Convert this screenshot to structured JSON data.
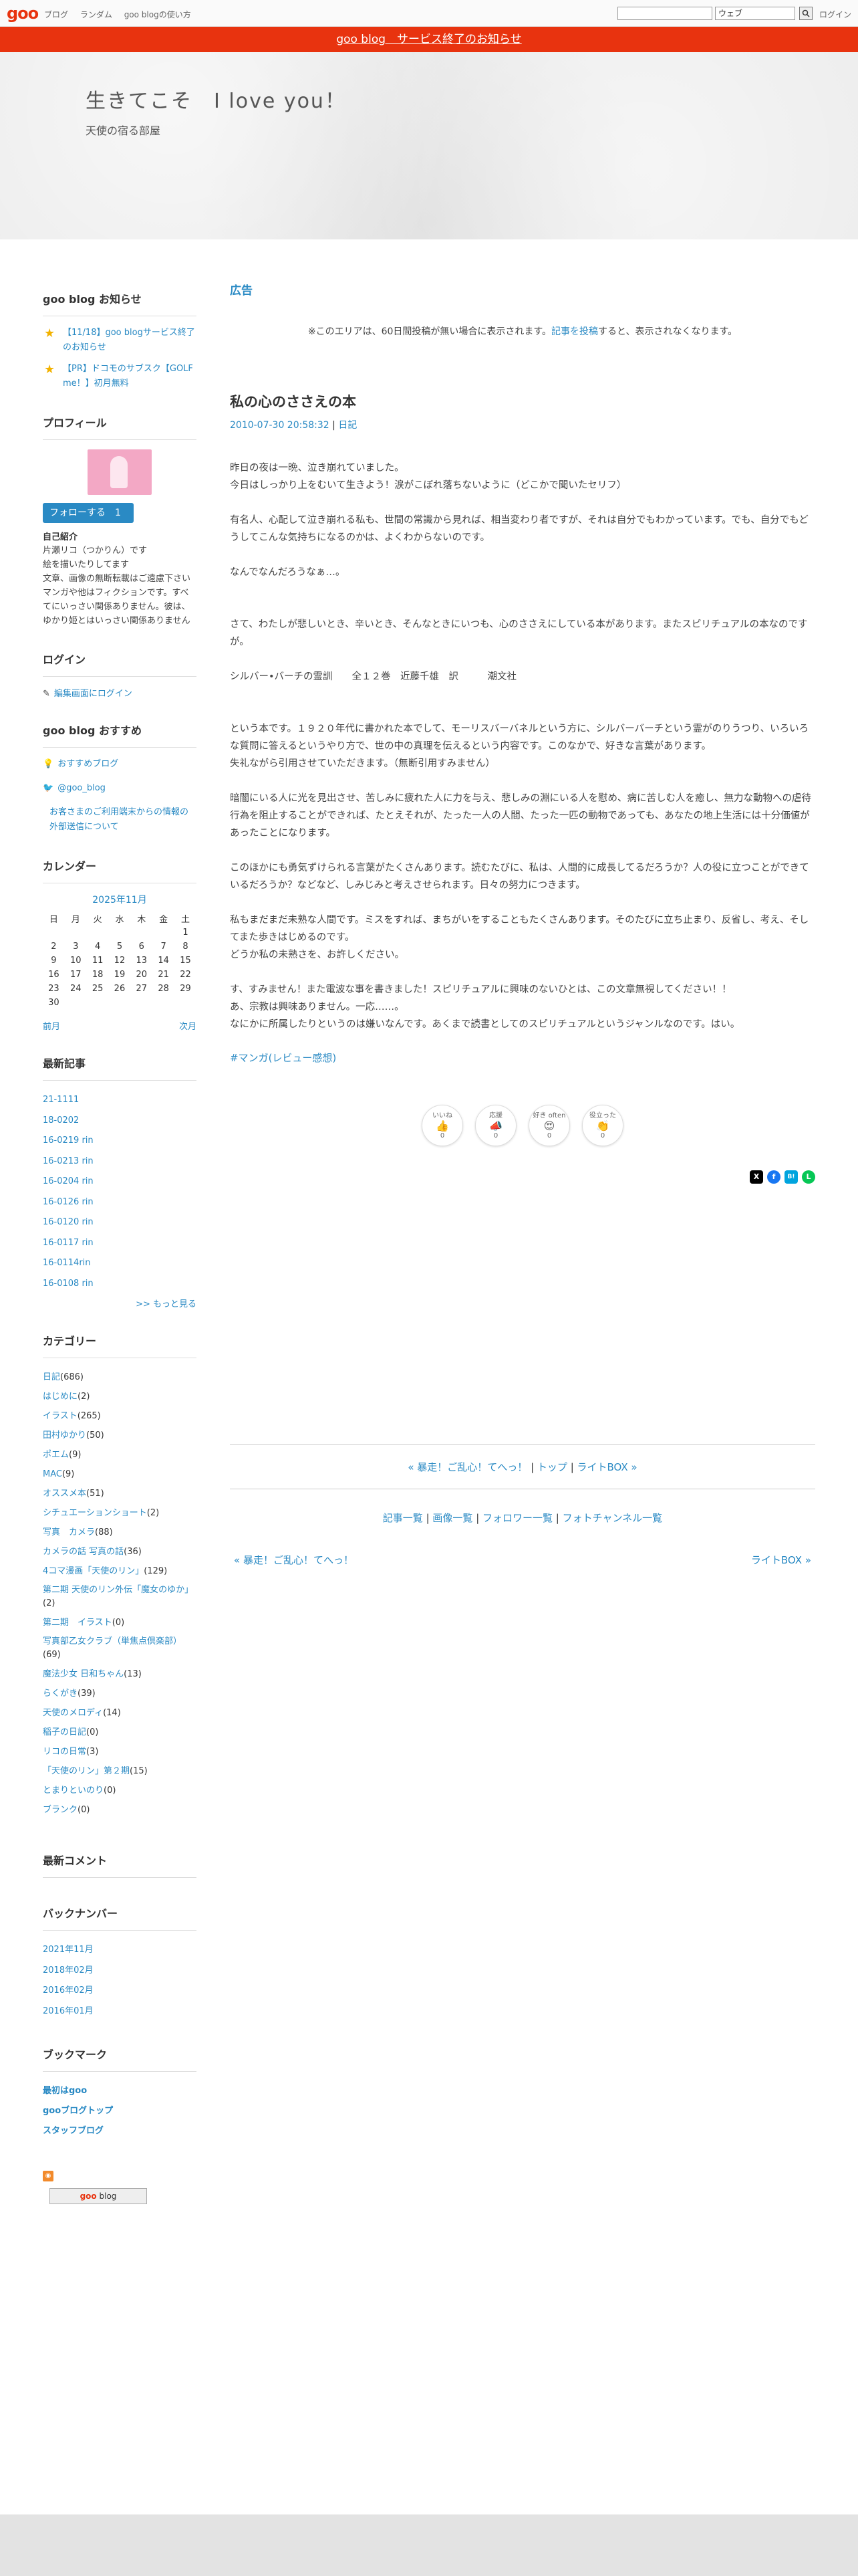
{
  "topbar": {
    "logo": "goo",
    "nav": [
      "ブログ",
      "ランダム",
      "goo blogの使い方"
    ],
    "search_select": "ウェブ",
    "login": "ログイン"
  },
  "notice": "goo blog　サービス終了のお知らせ",
  "header": {
    "title": "生きてこそ　I love you！",
    "description": "天使の宿る部屋"
  },
  "sidebar": {
    "news_title": "goo blog お知らせ",
    "news": [
      "【11/18】goo blogサービス終了のお知らせ",
      "【PR】ドコモのサブスク【GOLF me！】初月無料"
    ],
    "profile_title": "プロフィール",
    "follow_label": "フォローする　1",
    "profile_label": "自己紹介",
    "profile_text": "片瀬リコ（つかりん）です\n絵を描いたりしてます\n文章、画像の無断転載はご遠慮下さい\nマンガや他はフィクションです。すべてにいっさい関係ありません。彼は、ゆかり姫とはいっさい関係ありません",
    "login_title": "ログイン",
    "login_link": "編集画面にログイン",
    "recommend_title": "goo blog おすすめ",
    "recommend": [
      "おすすめブログ",
      "@goo_blog",
      "お客さまのご利用端末からの情報の外部送信について"
    ],
    "calendar_title": "カレンダー",
    "calendar": {
      "month": "2025年11月",
      "weekdays": [
        "日",
        "月",
        "火",
        "水",
        "木",
        "金",
        "土"
      ],
      "weeks": [
        [
          "",
          "",
          "",
          "",
          "",
          "",
          "1"
        ],
        [
          "2",
          "3",
          "4",
          "5",
          "6",
          "7",
          "8"
        ],
        [
          "9",
          "10",
          "11",
          "12",
          "13",
          "14",
          "15"
        ],
        [
          "16",
          "17",
          "18",
          "19",
          "20",
          "21",
          "22"
        ],
        [
          "23",
          "24",
          "25",
          "26",
          "27",
          "28",
          "29"
        ],
        [
          "30",
          "",
          "",
          "",
          "",
          "",
          ""
        ]
      ],
      "prev": "前月",
      "next": "次月"
    },
    "recent_title": "最新記事",
    "recent": [
      "21-1111",
      "18-0202",
      "16-0219 rin",
      "16-0213 rin",
      "16-0204 rin",
      "16-0126 rin",
      "16-0120 rin",
      "16-0117 rin",
      "16-0114rin",
      "16-0108 rin"
    ],
    "recent_more": ">> もっと見る",
    "categories_title": "カテゴリー",
    "categories": [
      {
        "name": "日記",
        "count": "(686)"
      },
      {
        "name": "はじめに",
        "count": "(2)"
      },
      {
        "name": "イラスト",
        "count": "(265)"
      },
      {
        "name": "田村ゆかり",
        "count": "(50)"
      },
      {
        "name": "ポエム",
        "count": "(9)"
      },
      {
        "name": "MAC",
        "count": "(9)"
      },
      {
        "name": "オススメ本",
        "count": "(51)"
      },
      {
        "name": "シチュエーションショート",
        "count": "(2)"
      },
      {
        "name": "写真　カメラ",
        "count": "(88)"
      },
      {
        "name": "カメラの話 写真の話",
        "count": "(36)"
      },
      {
        "name": "4コマ漫画「天使のリン」",
        "count": "(129)"
      },
      {
        "name": "第二期 天使のリン外伝「魔女のゆか」",
        "count": "(2)"
      },
      {
        "name": "第二期　イラスト",
        "count": "(0)"
      },
      {
        "name": "写真部乙女クラブ（単焦点倶楽部）",
        "count": "(69)"
      },
      {
        "name": "魔法少女 日和ちゃん",
        "count": "(13)"
      },
      {
        "name": "らくがき",
        "count": "(39)"
      },
      {
        "name": "天使のメロディ",
        "count": "(14)"
      },
      {
        "name": "稲子の日記",
        "count": "(0)"
      },
      {
        "name": "リコの日常",
        "count": "(3)"
      },
      {
        "name": "「天使のリン」第２期",
        "count": "(15)"
      },
      {
        "name": "とまりといのり",
        "count": "(0)"
      },
      {
        "name": "ブランク",
        "count": "(0)"
      }
    ],
    "comments_title": "最新コメント",
    "backnumber_title": "バックナンバー",
    "backnumbers": [
      "2021年11月",
      "2018年02月",
      "2016年02月",
      "2016年01月"
    ],
    "bookmark_title": "ブックマーク",
    "bookmarks": [
      "最初はgoo",
      "gooブログトップ",
      "スタッフブログ"
    ],
    "badge_prefix": "goo",
    "badge_suffix": " blog"
  },
  "main": {
    "ad_title": "広告",
    "ad_note_prefix": "※このエリアは、60日間投稿が無い場合に表示されます。",
    "ad_note_link": "記事を投稿",
    "ad_note_suffix": "すると、表示されなくなります。",
    "entry_title": "私の心のささえの本",
    "entry_date": "2010-07-30 20:58:32",
    "entry_sep": " | ",
    "entry_category": "日記",
    "paragraphs": [
      "昨日の夜は一晩、泣き崩れていました。\n今日はしっかり上をむいて生きよう！涙がこぼれ落ちないように（どこかで聞いたセリフ）",
      "有名人、心配して泣き崩れる私も、世間の常識から見れば、相当変わり者ですが、それは自分でもわかっています。でも、自分でもどうしてこんな気持ちになるのかは、よくわからないのです。",
      "なんでなんだろうなぁ…。",
      "\nさて、わたしが悲しいとき、辛いとき、そんなときにいつも、心のささえにしている本があります。またスピリチュアルの本なのですが。",
      "シルバー•バーチの霊訓　　全１２巻　近藤千雄　訳　　　潮文社",
      "\nという本です。１９２０年代に書かれた本でして、モーリスバーバネルという方に、シルバーバーチという霊がのりうつり、いろいろな質問に答えるというやり方で、世の中の真理を伝えるという内容です。このなかで、好きな言葉があります。\n失礼ながら引用させていただきます。（無断引用すみません）",
      "暗闇にいる人に光を見出させ、苦しみに疲れた人に力を与え、悲しみの淵にいる人を慰め、病に苦しむ人を癒し、無力な動物への虐待行為を阻止することができれば、たとえそれが、たった一人の人間、たった一匹の動物であっても、あなたの地上生活には十分価値があったことになります。",
      "このほかにも勇気ずけられる言葉がたくさんあります。読むたびに、私は、人間的に成長してるだろうか？人の役に立つことができているだろうか？などなど、しみじみと考えさせられます。日々の努力につきます。",
      "私もまだまだ未熟な人間です。ミスをすれば、まちがいをすることもたくさんあります。そのたびに立ち止まり、反省し、考え、そしてまた歩きはじめるのです。\nどうか私の未熟さを、お許しください。",
      "す、すみません！また電波な事を書きました！スピリチュアルに興味のないひとは、この文章無視してください！！\nあ、宗教は興味ありません。一応……。\nなにかに所属したりというのは嫌いなんです。あくまで読書としてのスピリチュアルというジャンルなのです。はい。"
    ],
    "tag": "#マンガ(レビュー感想)",
    "reactions": [
      {
        "label": "いいね",
        "emoji": "👍",
        "count": "0"
      },
      {
        "label": "応援",
        "emoji": "📣",
        "count": "0"
      },
      {
        "label": "好き often",
        "emoji": "😍",
        "count": "0"
      },
      {
        "label": "役立った",
        "emoji": "👏",
        "count": "0"
      }
    ],
    "share": [
      "X",
      "f",
      "B!",
      "L"
    ],
    "pager_prev": "« 暴走！ご乱心！てへっ！",
    "pager_top": "トップ",
    "pager_next": "ライトBOX »",
    "pager_sep": " | ",
    "links": [
      "記事一覧",
      "画像一覧",
      "フォロワー一覧",
      "フォトチャンネル一覧"
    ],
    "prev_link": "« 暴走！ご乱心！てへっ！",
    "next_link": "ライトBOX »"
  }
}
